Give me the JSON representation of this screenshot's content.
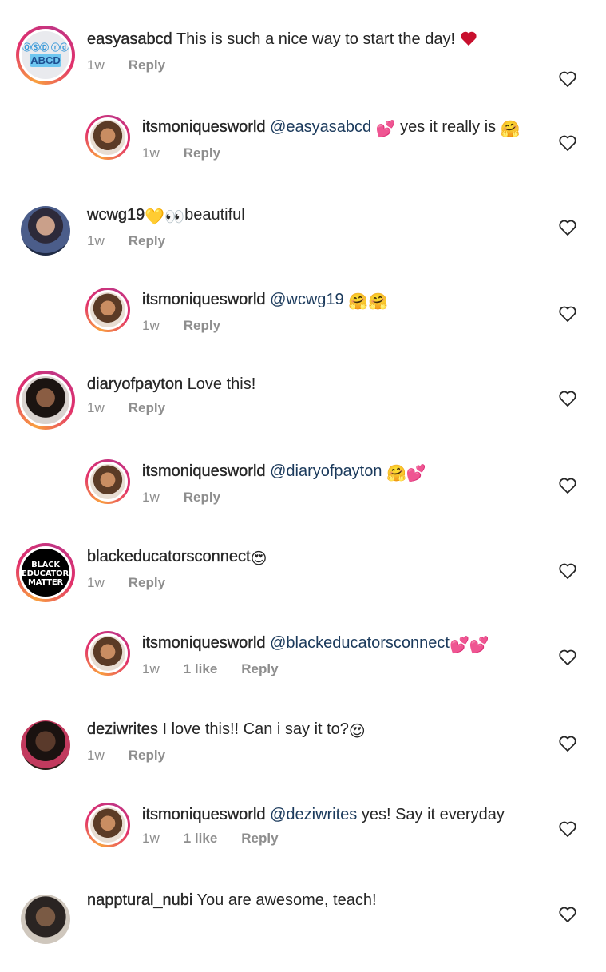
{
  "comments": [
    {
      "username": "easyasabcd",
      "mention": "",
      "text": "This is such a nice way to start the day!",
      "emoji": "❤️",
      "time": "1w",
      "likes": "",
      "reply": "Reply",
      "avatar_text": [
        "Ⓞⓢⓓ ⓡⓓ",
        "ABCD"
      ]
    },
    {
      "username": "itsmoniquesworld",
      "mention": "@easyasabcd",
      "text": "yes it really is",
      "emoji_mid": "💕",
      "emoji": "🤗",
      "time": "1w",
      "likes": "",
      "reply": "Reply"
    },
    {
      "username": "wcwg19",
      "mention": "",
      "text": "beautiful",
      "emoji_mid": "💛👀",
      "emoji": "",
      "time": "1w",
      "likes": "",
      "reply": "Reply"
    },
    {
      "username": "itsmoniquesworld",
      "mention": "@wcwg19",
      "text": "",
      "emoji": "🤗🤗",
      "time": "1w",
      "likes": "",
      "reply": "Reply"
    },
    {
      "username": "diaryofpayton",
      "mention": "",
      "text": "Love this!",
      "emoji": "",
      "time": "1w",
      "likes": "",
      "reply": "Reply"
    },
    {
      "username": "itsmoniquesworld",
      "mention": "@diaryofpayton",
      "text": "",
      "emoji": "🤗💕",
      "time": "1w",
      "likes": "",
      "reply": "Reply"
    },
    {
      "username": "blackeducatorsconnect",
      "mention": "",
      "text": "",
      "emoji": "😍",
      "time": "1w",
      "likes": "",
      "reply": "Reply",
      "avatar_text": "BLACK EDUCATORS MATTER"
    },
    {
      "username": "itsmoniquesworld",
      "mention": "@blackeducatorsconnect",
      "text": "",
      "emoji": "💕💕",
      "time": "1w",
      "likes": "1 like",
      "reply": "Reply"
    },
    {
      "username": "deziwrites",
      "mention": "",
      "text": "I love this!! Can i say it to?",
      "emoji": "😍",
      "time": "1w",
      "likes": "",
      "reply": "Reply"
    },
    {
      "username": "itsmoniquesworld",
      "mention": "@deziwrites",
      "text": "yes! Say it everyday",
      "emoji": "",
      "time": "1w",
      "likes": "1 like",
      "reply": "Reply"
    },
    {
      "username": "napptural_nubi",
      "mention": "",
      "text": "You are awesome, teach!",
      "emoji": "",
      "time": "",
      "likes": "",
      "reply": ""
    }
  ],
  "colors": {
    "ring_start": "#f9a03f",
    "ring_end": "#c13584",
    "mention": "#1b3a5c",
    "meta": "#8e8e8e"
  },
  "icons": {
    "like": "heart-outline-icon"
  }
}
